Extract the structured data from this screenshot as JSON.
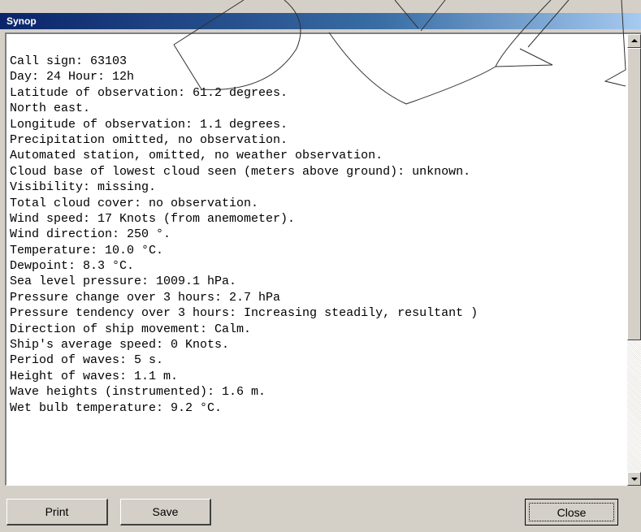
{
  "window": {
    "title": "Synop"
  },
  "report": {
    "lines": [
      "Call sign: 63103",
      "Day: 24 Hour: 12h",
      "Latitude of observation: 61.2 degrees.",
      "North east.",
      "Longitude of observation: 1.1 degrees.",
      "Precipitation omitted, no observation.",
      "Automated station, omitted, no weather observation.",
      "Cloud base of lowest cloud seen (meters above ground): unknown.",
      "Visibility: missing.",
      "Total cloud cover: no observation.",
      "Wind speed: 17 Knots (from anemometer).",
      "Wind direction: 250 °.",
      "Temperature: 10.0 °C.",
      "Dewpoint: 8.3 °C.",
      "Sea level pressure: 1009.1 hPa.",
      "Pressure change over 3 hours: 2.7 hPa",
      "Pressure tendency over 3 hours: Increasing steadily, resultant )",
      "Direction of ship movement: Calm.",
      "Ship's average speed: 0 Knots.",
      "Period of waves: 5 s.",
      "Height of waves: 1.1 m.",
      "Wave heights (instrumented): 1.6 m.",
      "Wet bulb temperature: 9.2 °C."
    ]
  },
  "buttons": {
    "print": "Print",
    "save": "Save",
    "close": "Close"
  },
  "icons": {
    "scroll_up": "arrow-up-icon",
    "scroll_down": "arrow-down-icon"
  }
}
